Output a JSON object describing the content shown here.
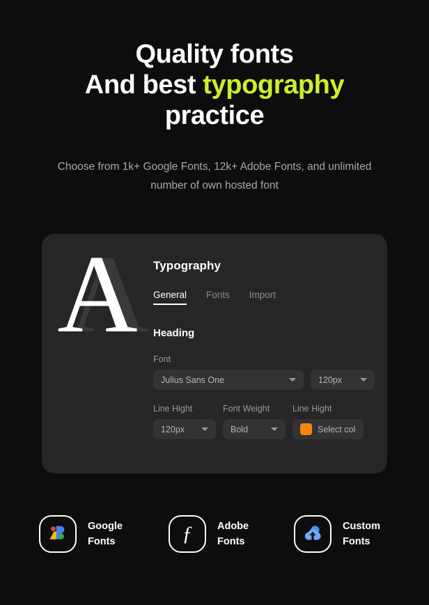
{
  "hero": {
    "line1": "Quality fonts",
    "line2_a": "And best ",
    "line2_accent": "typography",
    "line3": "practice",
    "accent_color": "#cbf02b",
    "subtitle_line1": "Choose from 1k+ Google Fonts, 12k+ Adobe Fonts, and",
    "subtitle_line2": "unlimited number of own hosted font"
  },
  "card": {
    "glyph": "A",
    "title": "Typography",
    "tabs": [
      {
        "label": "General",
        "active": true
      },
      {
        "label": "Fonts",
        "active": false
      },
      {
        "label": "Import",
        "active": false
      }
    ],
    "section_title": "Heading",
    "fields": {
      "font_label": "Font",
      "font_value": "Julius Sans One",
      "font_size_value": "120px",
      "line_height_label": "Line Hight",
      "line_height_value": "120px",
      "font_weight_label": "Font Weight",
      "font_weight_value": "Bold",
      "color_label": "Line Hight",
      "color_button_label": "Select color",
      "color_swatch": "#f5870f"
    }
  },
  "badges": [
    {
      "icon": "google-fonts-icon",
      "label": "Google\nFonts"
    },
    {
      "icon": "adobe-fonts-icon",
      "label": "Adobe\nFonts"
    },
    {
      "icon": "custom-fonts-cloud-upload-icon",
      "label": "Custom\nFonts"
    }
  ]
}
